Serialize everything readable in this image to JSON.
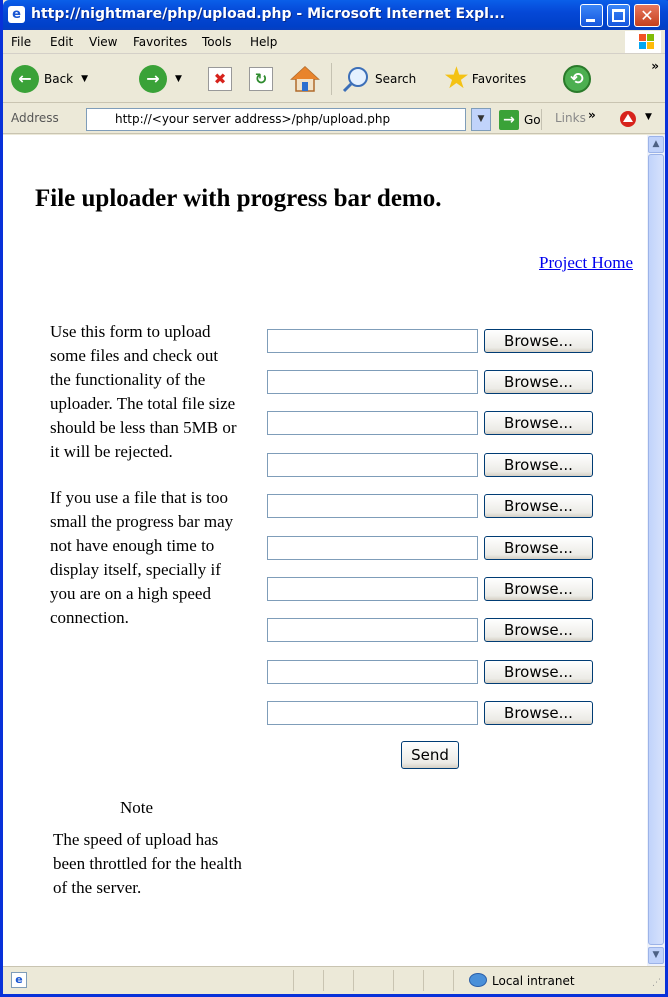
{
  "window": {
    "title": "http://nightmare/php/upload.php - Microsoft Internet Expl..."
  },
  "menu": [
    "File",
    "Edit",
    "View",
    "Favorites",
    "Tools",
    "Help"
  ],
  "toolbar": {
    "back_label": "Back",
    "search_label": "Search",
    "favorites_label": "Favorites"
  },
  "address": {
    "label": "Address",
    "url": "http://<your server address>/php/upload.php",
    "go_label": "Go",
    "links_label": "Links"
  },
  "page": {
    "heading": "File uploader with progress bar demo.",
    "project_link": "Project Home",
    "description_1": "Use this form to upload some files and check out the functionality of the uploader. The total file size should be less than 5MB or it will be rejected.",
    "description_2": "If you use a file that is too small the progress bar may not have enough time to display itself, specially if you are on a high speed connection.",
    "note_title": "Note",
    "note_body": "The speed of upload has been throttled for the health of the server.",
    "browse_label": "Browse...",
    "send_label": "Send"
  },
  "status": {
    "zone": "Local intranet"
  },
  "colors": {
    "titlebar": "#0548d7",
    "link": "#0000ee",
    "chrome": "#ece9d8"
  }
}
